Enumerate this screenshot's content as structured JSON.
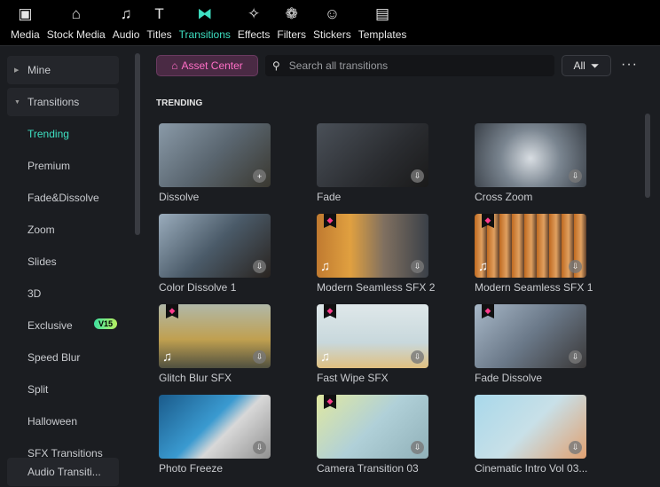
{
  "topbar": {
    "tabs": [
      {
        "label": "Media",
        "icon": "media-icon",
        "glyph": "▣"
      },
      {
        "label": "Stock Media",
        "icon": "stock-media-icon",
        "glyph": "⌂"
      },
      {
        "label": "Audio",
        "icon": "audio-icon",
        "glyph": "♫"
      },
      {
        "label": "Titles",
        "icon": "titles-icon",
        "glyph": "T"
      },
      {
        "label": "Transitions",
        "icon": "transitions-icon",
        "glyph": "⧓"
      },
      {
        "label": "Effects",
        "icon": "effects-icon",
        "glyph": "✧"
      },
      {
        "label": "Filters",
        "icon": "filters-icon",
        "glyph": "❁"
      },
      {
        "label": "Stickers",
        "icon": "stickers-icon",
        "glyph": "☺"
      },
      {
        "label": "Templates",
        "icon": "templates-icon",
        "glyph": "▤"
      }
    ],
    "active": "Transitions",
    "accent": "#3ee0c2"
  },
  "sidebar": {
    "mine": "Mine",
    "transitions": "Transitions",
    "items": [
      "Trending",
      "Premium",
      "Fade&Dissolve",
      "Zoom",
      "Slides",
      "3D",
      "Exclusive",
      "Speed Blur",
      "Split",
      "Halloween",
      "SFX Transitions"
    ],
    "exclusive_badge": "V15",
    "audio": "Audio Transiti..."
  },
  "toolbar": {
    "asset_center": "Asset Center",
    "search_placeholder": "Search all transitions",
    "filter": "All",
    "more": "···"
  },
  "section": "TRENDING",
  "cards": [
    {
      "label": "Dissolve",
      "action": "+",
      "premium": false,
      "sfx": false,
      "bg": "linear-gradient(135deg,#8a9aa8,#5a6670 50%,#3a3830)"
    },
    {
      "label": "Fade",
      "action": "⇩",
      "premium": false,
      "sfx": false,
      "bg": "linear-gradient(135deg,#4a5058,#2a2c30 60%,#1a1a1a)"
    },
    {
      "label": "Cross Zoom",
      "action": "⇩",
      "premium": false,
      "sfx": false,
      "bg": "radial-gradient(circle at 50% 55%,#d8dde2,#7a8590 45%,#3a4048)"
    },
    {
      "label": "Color Dissolve 1",
      "action": "⇩",
      "premium": false,
      "sfx": false,
      "bg": "linear-gradient(135deg,#9aacbc,#4a5a68 50%,#2a2420)"
    },
    {
      "label": "Modern Seamless SFX 2",
      "action": "⇩",
      "premium": true,
      "sfx": true,
      "bg": "linear-gradient(90deg,#c07a30,#e0a040 30%,#807060 60%,#3a4048)"
    },
    {
      "label": "Modern Seamless SFX 1",
      "action": "⇩",
      "premium": true,
      "sfx": true,
      "bg": "repeating-linear-gradient(90deg,#c06a20,#e0a060 8px,#60402a 14px)"
    },
    {
      "label": "Glitch Blur SFX",
      "action": "⇩",
      "premium": true,
      "sfx": true,
      "bg": "linear-gradient(180deg,#b0b8a8,#c0a050 55%,#505040)"
    },
    {
      "label": "Fast Wipe SFX",
      "action": "⇩",
      "premium": true,
      "sfx": true,
      "bg": "linear-gradient(180deg,#dfe8ea,#c8d8dc 60%,#e0c080)"
    },
    {
      "label": "Fade Dissolve",
      "action": "⇩",
      "premium": true,
      "sfx": false,
      "bg": "linear-gradient(135deg,#a8b8c8,#6a7888 50%,#3a3838)"
    },
    {
      "label": "Photo Freeze",
      "action": "⇩",
      "premium": false,
      "sfx": false,
      "bg": "linear-gradient(135deg,#1a5a8a,#3a9ad0 45%,#d8d8d8 60%,#909090)"
    },
    {
      "label": "Camera Transition 03",
      "action": "⇩",
      "premium": true,
      "sfx": false,
      "bg": "linear-gradient(135deg,#e0e8a0,#b0d0d8 50%,#90b0b8)"
    },
    {
      "label": "Cinematic Intro Vol 03...",
      "action": "⇩",
      "premium": false,
      "sfx": false,
      "bg": "linear-gradient(135deg,#a8d8ea,#c8e0e8 50%,#e0a070)"
    }
  ]
}
